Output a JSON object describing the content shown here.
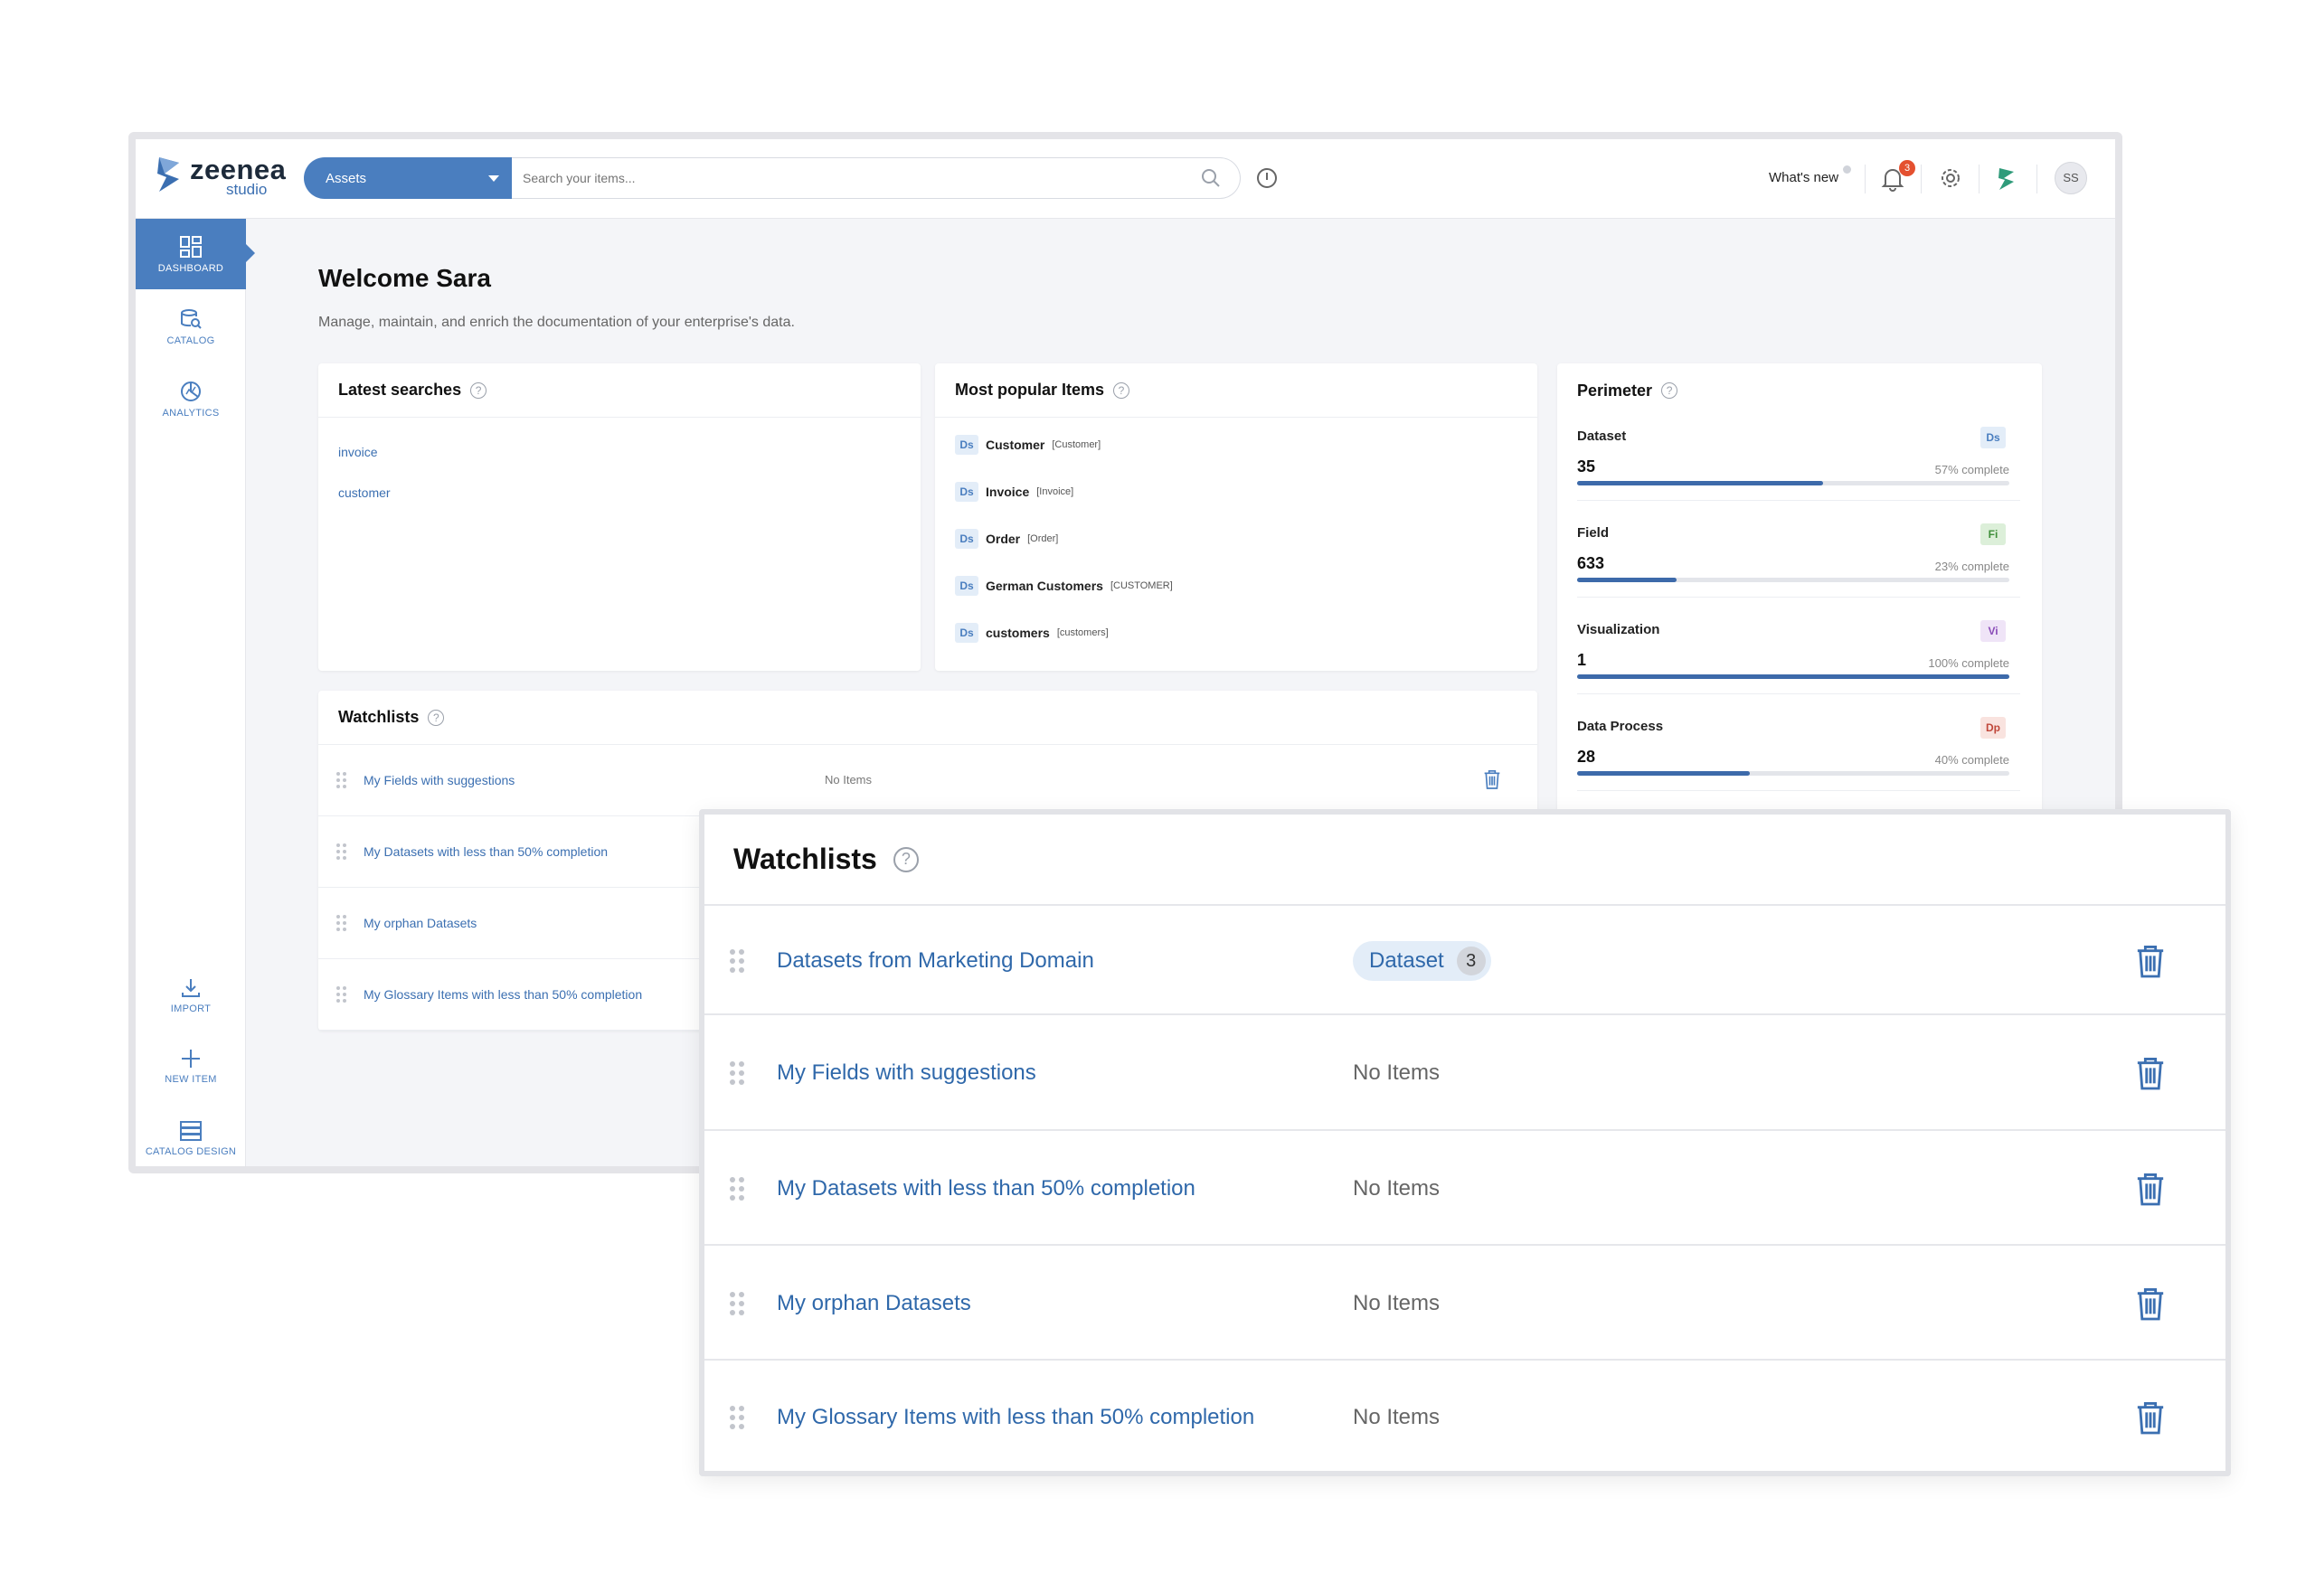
{
  "brand": {
    "name": "zeenea",
    "sub": "studio"
  },
  "header": {
    "search_scope": "Assets",
    "search_placeholder": "Search your items...",
    "whats_new": "What's new",
    "notifications_count": "3",
    "avatar_initials": "SS"
  },
  "sidebar": {
    "top": [
      {
        "label": "DASHBOARD",
        "icon": "dashboard-icon"
      },
      {
        "label": "CATALOG",
        "icon": "catalog-icon"
      },
      {
        "label": "ANALYTICS",
        "icon": "analytics-icon"
      }
    ],
    "bottom": [
      {
        "label": "IMPORT",
        "icon": "import-icon"
      },
      {
        "label": "NEW ITEM",
        "icon": "plus-icon"
      },
      {
        "label": "CATALOG DESIGN",
        "icon": "catalog-design-icon"
      }
    ]
  },
  "welcome": {
    "title": "Welcome Sara",
    "subtitle": "Manage, maintain, and enrich the documentation of your enterprise's data."
  },
  "latest_searches": {
    "title": "Latest searches",
    "items": [
      "invoice",
      "customer"
    ]
  },
  "popular": {
    "title": "Most popular Items",
    "items": [
      {
        "type": "Ds",
        "name": "Customer",
        "technical": "[Customer]"
      },
      {
        "type": "Ds",
        "name": "Invoice",
        "technical": "[Invoice]"
      },
      {
        "type": "Ds",
        "name": "Order",
        "technical": "[Order]"
      },
      {
        "type": "Ds",
        "name": "German Customers",
        "technical": "[CUSTOMER]"
      },
      {
        "type": "Ds",
        "name": "customers",
        "technical": "[customers]"
      }
    ]
  },
  "perimeter": {
    "title": "Perimeter",
    "items": [
      {
        "name": "Dataset",
        "tag": "Ds",
        "count": "35",
        "percent": 57,
        "percent_label": "57% complete",
        "tag_bg": "#e3edf8",
        "tag_fg": "#4a7ebf"
      },
      {
        "name": "Field",
        "tag": "Fi",
        "count": "633",
        "percent": 23,
        "percent_label": "23% complete",
        "tag_bg": "#dcefd9",
        "tag_fg": "#3f8f3a"
      },
      {
        "name": "Visualization",
        "tag": "Vi",
        "count": "1",
        "percent": 100,
        "percent_label": "100% complete",
        "tag_bg": "#efe4f7",
        "tag_fg": "#8a4cb8"
      },
      {
        "name": "Data Process",
        "tag": "Dp",
        "count": "28",
        "percent": 40,
        "percent_label": "40% complete",
        "tag_bg": "#f9e3df",
        "tag_fg": "#c0473a"
      }
    ]
  },
  "watchlists_bg": {
    "title": "Watchlists",
    "rows": [
      {
        "name": "My Fields with suggestions",
        "status": "No Items"
      },
      {
        "name": "My Datasets with less than 50% completion",
        "status": ""
      },
      {
        "name": "My orphan Datasets",
        "status": ""
      },
      {
        "name": "My Glossary Items with less than 50% completion",
        "status": ""
      }
    ]
  },
  "watchlists_overlay": {
    "title": "Watchlists",
    "rows": [
      {
        "name": "Datasets from Marketing Domain",
        "pill_label": "Dataset",
        "pill_count": "3"
      },
      {
        "name": "My Fields with suggestions",
        "status": "No Items"
      },
      {
        "name": "My Datasets with less than 50% completion",
        "status": "No Items"
      },
      {
        "name": "My orphan Datasets",
        "status": "No Items"
      },
      {
        "name": "My Glossary Items with less than 50% completion",
        "status": "No Items"
      }
    ]
  },
  "colors": {
    "accent": "#4a7ebf",
    "link": "#3b6fb1",
    "badge": "#e4502f"
  }
}
